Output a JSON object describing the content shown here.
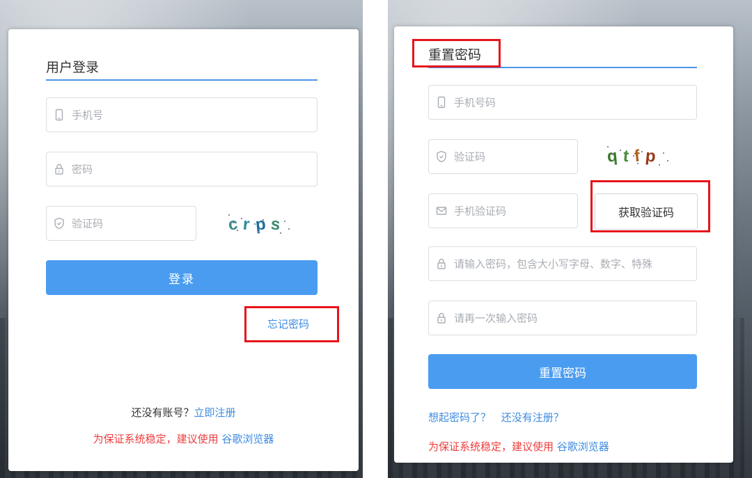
{
  "login_card": {
    "title": "用户登录",
    "phone_placeholder": "手机号",
    "password_placeholder": "密码",
    "captcha_placeholder": "验证码",
    "captcha_chars": [
      "c",
      "r",
      "p",
      "s"
    ],
    "captcha_colors": [
      "#3a8a8a",
      "#2a8a9a",
      "#1e6e9e",
      "#3c8c6c"
    ],
    "login_button": "登录",
    "forgot_link": "忘记密码",
    "no_account_text": "还没有账号？",
    "register_link": "立即注册",
    "browser_tip": "为保证系统稳定，建议使用",
    "browser_link": "谷歌浏览器"
  },
  "reset_card": {
    "title": "重置密码",
    "phone_placeholder": "手机号码",
    "captcha_placeholder": "验证码",
    "captcha_chars": [
      "q",
      "t",
      "f",
      "p"
    ],
    "captcha_colors": [
      "#3a7a2a",
      "#4a8a3a",
      "#b06020",
      "#9a3a1a"
    ],
    "sms_code_placeholder": "手机验证码",
    "get_code_button": "获取验证码",
    "new_password_placeholder": "请输入密码，包含大小写字母、数字、特殊",
    "confirm_password_placeholder": "请再一次输入密码",
    "reset_button": "重置密码",
    "remembered_link": "想起密码了？",
    "not_registered_link": "还没有注册？",
    "browser_tip": "为保证系统稳定，建议使用",
    "browser_link": "谷歌浏览器"
  },
  "colors": {
    "accent": "#4a9cf0",
    "link": "#3d8be0",
    "warning": "#ee3d3d",
    "highlight_box": "#e6141b"
  },
  "icons": {
    "phone": "phone-icon",
    "lock": "lock-icon",
    "shield": "shield-icon",
    "mail": "mail-icon"
  }
}
